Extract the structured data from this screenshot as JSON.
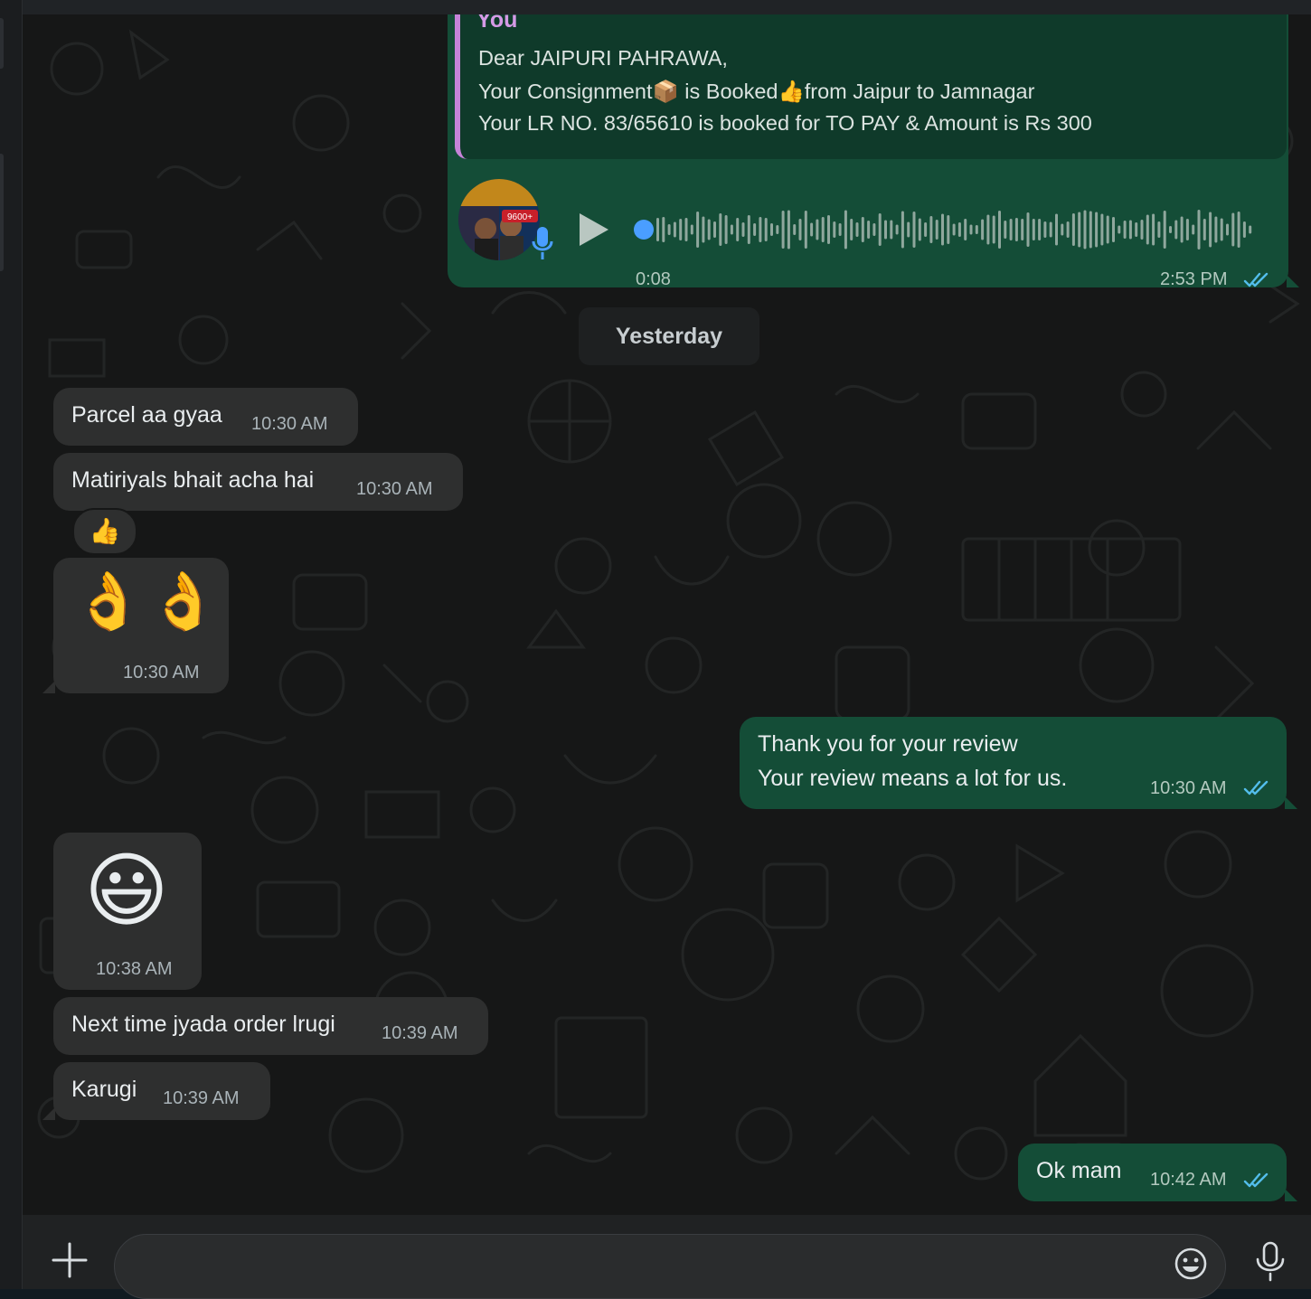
{
  "quoted_message": {
    "author": "You",
    "lines": [
      "Dear JAIPURI PAHRAWA,",
      "Your Consignment📦 is Booked👍from Jaipur to Jamnagar",
      "Your LR NO. 83/65610 is booked for TO PAY & Amount is Rs 300"
    ]
  },
  "voice_message": {
    "duration": "0:08",
    "time": "2:53 PM",
    "avatar_badge_text": "9600+",
    "progress": 0.0
  },
  "day_divider": "Yesterday",
  "messages": [
    {
      "text": "Parcel aa gyaa",
      "time": "10:30 AM"
    },
    {
      "text": "Matiriyals bhait acha hai",
      "time": "10:30 AM",
      "reaction": "👍"
    },
    {
      "emoji": "👌👌",
      "time": "10:30 AM"
    },
    {
      "lines": [
        "Thank you for your review",
        "Your review means a lot for us."
      ],
      "time": "10:30 AM"
    },
    {
      "emoji": "😃",
      "time": "10:38 AM"
    },
    {
      "text": "Next time jyada order lrugi",
      "time": "10:39 AM"
    },
    {
      "text": "Karugi",
      "time": "10:39 AM"
    },
    {
      "text": "Ok mam",
      "time": "10:42 AM"
    }
  ],
  "composer": {
    "placeholder": "",
    "icons": [
      "plus-icon",
      "emoji-icon",
      "microphone-icon"
    ]
  },
  "colors": {
    "incoming_bubble": "#2e2f2f",
    "outgoing_bubble": "#144d37",
    "read_ticks": "#53bdeb",
    "quote_accent": "#c683d8",
    "play_dot": "#4a9eff"
  }
}
